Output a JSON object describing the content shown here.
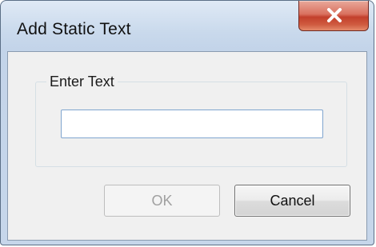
{
  "window": {
    "title": "Add Static Text",
    "close_icon": "close-icon"
  },
  "group": {
    "label": "Enter Text"
  },
  "input": {
    "value": "",
    "placeholder": ""
  },
  "buttons": {
    "ok_label": "OK",
    "ok_enabled": false,
    "cancel_label": "Cancel"
  },
  "colors": {
    "close_button": "#c94a36",
    "titlebar": "#c9d9ec",
    "client_bg": "#f0f0f0",
    "input_border": "#7fa5cf"
  }
}
